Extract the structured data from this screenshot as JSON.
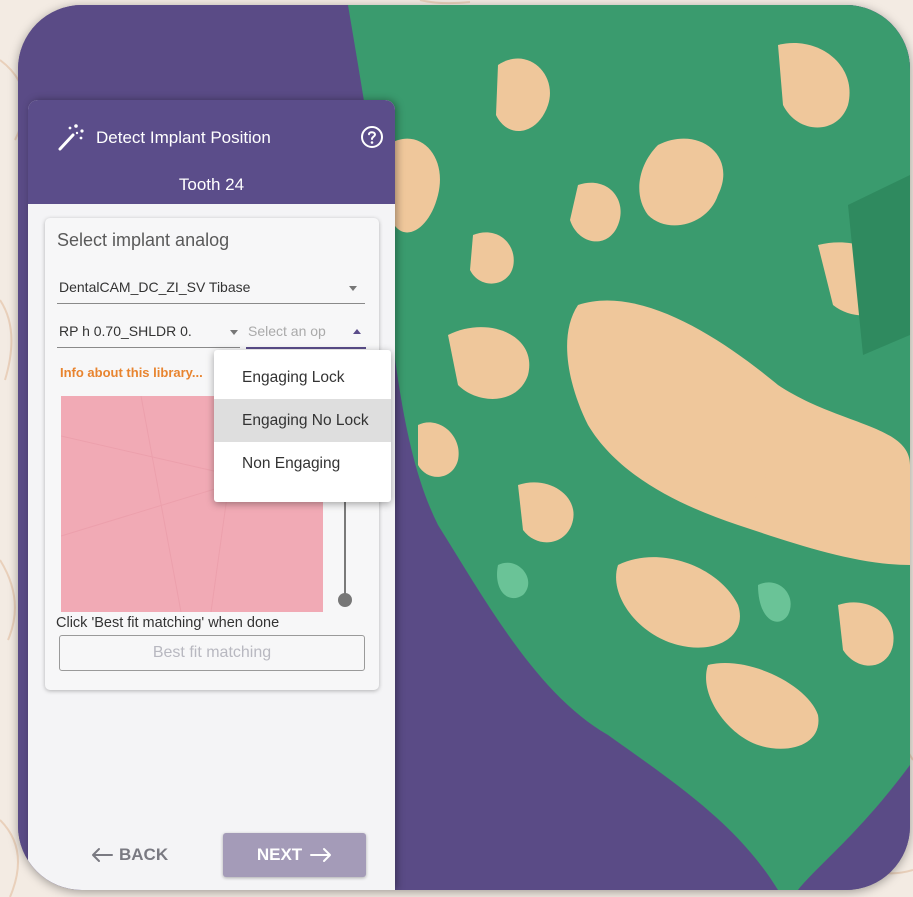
{
  "panel": {
    "title": "Detect Implant Position",
    "subtitle": "Tooth 24",
    "section_title": "Select implant analog",
    "analog_select": {
      "value": "DentalCAM_DC_ZI_SV Tibase"
    },
    "platform_select": {
      "value": "RP h 0.70_SHLDR 0."
    },
    "connection_select": {
      "placeholder": "Select an op"
    },
    "info_link": "Info about this library...",
    "hint": "Click 'Best fit matching' when done",
    "bestfit_label": "Best fit matching",
    "back_label": "BACK",
    "next_label": "NEXT"
  },
  "dropdown": {
    "options": [
      "Engaging Lock",
      "Engaging No Lock",
      "Non Engaging"
    ],
    "highlighted": "Engaging No Lock"
  },
  "icons": {
    "title_icon": "magic-wand-icon",
    "help_icon": "help-circle-icon",
    "back_icon": "arrow-left-icon",
    "next_icon": "arrow-right-icon",
    "caret": "chevron-down-icon"
  },
  "colors": {
    "header": "#5b4d8a",
    "viewport_bg": "#5a4b86",
    "scan_green": "#3a9b6e",
    "scan_beige": "#efc79b",
    "info_link": "#e8842f",
    "preview": "#f1aab5",
    "next_button": "#a49bb8"
  }
}
